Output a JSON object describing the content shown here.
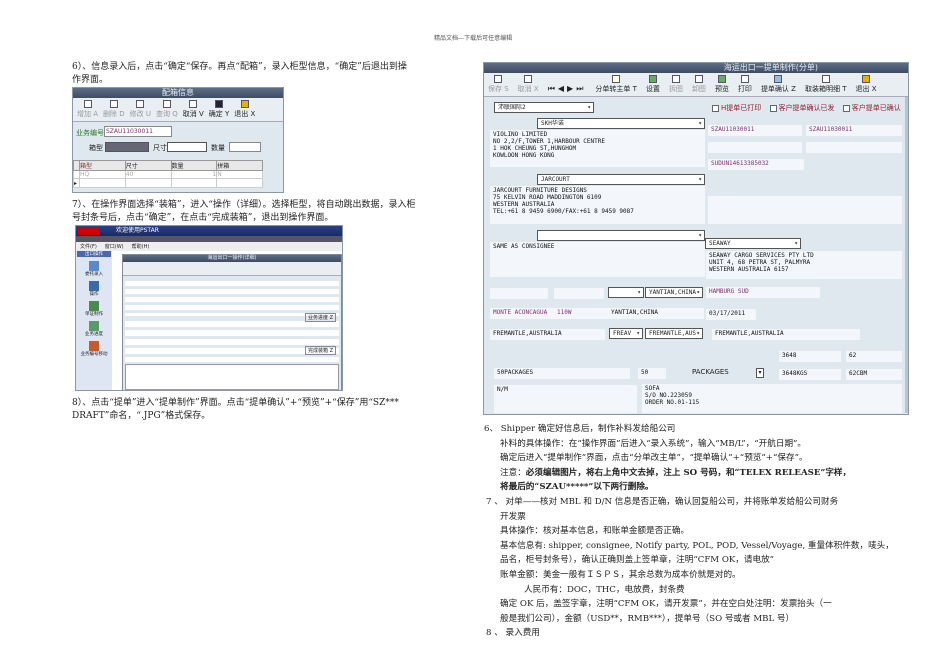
{
  "header": "精品文档---下载后可任意编辑",
  "left": {
    "step6": [
      "6）、信息录入后，点击“确定“保存。再点“配箱”，录入柜型信息，“确定”后退出到操",
      "作界面。"
    ],
    "dialog1": {
      "title": "配箱信息",
      "toolbar": [
        "增加 A",
        "删除 D",
        "修改 U",
        "查询 Q",
        "取消 V",
        "确定 Y",
        "退出 X"
      ],
      "biz_label": "业务编号",
      "biz_value": "SZAU11030011",
      "box_label": "箱型",
      "size_label": "尺寸",
      "qty_label": "数量",
      "columns": [
        "箱型",
        "尺寸",
        "数量",
        "拼箱"
      ],
      "row": [
        "HQ",
        "40",
        "1",
        "N"
      ]
    },
    "step7": [
      "7）、在操作界面选择“装箱”，进入“操作（详细）。选择柜型，将自动跳出数据，录入柜",
      "号封条号后，点击“确定”，在点击“完成装箱”，退出到操作界面。"
    ],
    "app2": {
      "welcome": "欢迎使用PSTAR",
      "menu": [
        "文件(F)",
        "窗口(W)",
        "帮助(H)"
      ],
      "sidebar": [
        "出口操作",
        "委托录入",
        "操作",
        "单证制作",
        "业务进度",
        "业务编号移动"
      ],
      "inner_title": "海运出口一操作(详细)",
      "complete": "完成装箱 Z",
      "progress": "业务进度 Z"
    },
    "step8": [
      "8）、点击“提单”进入“提单制作”界面。点击“提单确认”+“预览”+“保存”用“SZ***",
      "DRAFT”命名，“.JPG”格式保存。"
    ]
  },
  "bl": {
    "title": "海运出口一提单制作(分单)",
    "toolbar": [
      "保存 S",
      "取消 X",
      "分单转主单 T",
      "设置",
      "拆图",
      "卸图",
      "预览",
      "打印",
      "提单确认 Z",
      "取装箱明细 T",
      "退出 X"
    ],
    "company": "沛联国际2",
    "checks": [
      "H提单已打印",
      "客户提单确认已发",
      "客户提单已确认"
    ],
    "shipper_sel": "SKH华诺",
    "shipper": "VIOLINO LIMITED\nNO 2,2/F,TOWER 1,HARBOUR CENTRE\n1 HOK CHEUNG ST,HUNGHOM\nKOWLOON HONG KONG",
    "ref1": "SZAU11030011",
    "ref2": "SZAU11030011",
    "sudu": "SUDUN14613385032",
    "consignee_sel": "JARCOURT",
    "consignee": "JARCOURT FURNITURE DESIGNS\n75 KELVIN ROAD MADDINGTON 6109\nWESTERN AUSTRALIA\nTEL:+61 8 9459 6900/FAX:+61 8 9459 9087",
    "notify": "SAME AS CONSIGNEE",
    "agent_sel": "SEAWAY",
    "agent": "SEAWAY CARGO SERVICES PTY LTD\nUNIT 4, 68 PETRA ST, PALMYRA\nWESTERN AUSTRALIA 6157",
    "pol_sel": "YANTIAN,CHINA",
    "carrier": "HAMBURG SUD",
    "vessel": "MONTE ACONCAGUA",
    "voyage": "110W",
    "pol": "YANTIAN,CHINA",
    "date": "03/17/2011",
    "pod": "FREMANTLE,AUSTRALIA",
    "pod_code": "FREAV",
    "pod_sel": "FREMANTLE,AUS",
    "dest": "FREMANTLE,AUSTRALIA",
    "weight": "3648",
    "volume": "62",
    "pkgs_text": "50PACKAGES",
    "pkgs": "50",
    "unit": "PACKAGES",
    "weight_kg": "3648KGS",
    "cbm": "62CBM",
    "marks": "N/M",
    "desc": "SOFA\nS/O NO.223059\nORDER NO.01-115"
  },
  "right": {
    "lines": [
      "6、 Shipper 确定好信息后，制作补料发给船公司",
      "补料的具体操作：在“操作界面”后进入“录入系统”，输入“MB/L”，“开航日期”。",
      "确定后进入“提单制作”界面，点击“分单改主单”，“提单确认”+“预览”+“保存”。",
      "注意：",
      "必须编辑图片，将右上角中文去掉，注上 SO 号码，和“TELEX RELEASE”字样，",
      "将最后的“SZAU*****”以下两行删除。",
      "7 、   对单——核对 MBL 和 D/N 信息是否正确，确认回复船公司，并将账单发给船公司财务",
      "开发票",
      "具体操作：核对基本信息，和账单金额是否正确。",
      "基本信息有: shipper, consignee, Notify party, POL, POD, Vessel/Voyage, 重量体积件数，唛头，",
      "品名，柜号封条号），确认正确则盖上签单章，注明“CFM OK，请电放”",
      "账单金额：美金一般有ＩＳＰＳ，其余总数为成本价就是对的。",
      "人民币有：DOC，THC，电放费，封条费",
      "确定 OK 后，盖签字章，注明“CFM OK，请开发票”，并在空白处注明：发票抬头（一",
      "般是我们公司），金额（USD**，RMB***），提单号（SO 号或者 MBL 号）",
      "8 、   录入费用"
    ]
  }
}
